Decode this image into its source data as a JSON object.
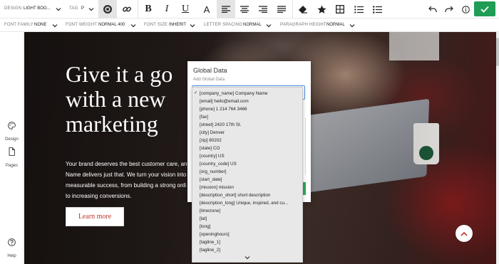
{
  "toolbar": {
    "design_label": "DESIGN",
    "design_value": "LIGHT BOO...",
    "tag_label": "TAG",
    "tag_value": "P",
    "buttons": [
      "palette-icon",
      "link-icon",
      "bold",
      "italic",
      "underline",
      "text-color",
      "align-left",
      "align-center",
      "align-right",
      "align-justify",
      "eraser-icon",
      "star-icon",
      "table-icon",
      "list-icon",
      "numbered-list-icon",
      "undo-icon",
      "redo-icon",
      "info-icon",
      "save-check-icon"
    ],
    "bold_label": "B",
    "italic_label": "I",
    "underline_label": "U",
    "color_label": "A"
  },
  "fontbar": {
    "family_label": "FONT FAMILY",
    "family_value": "NONE",
    "weight_label": "FONT WEIGHT",
    "weight_value": "NORMAL 400",
    "size_label": "FONT SIZE",
    "size_value": "INHERIT",
    "spacing_label": "LETTER SPACING",
    "spacing_value": "NORMAL",
    "para_label": "PARAGRAPH HEIGHT",
    "para_value": "NORMAL"
  },
  "sidebar": {
    "design": "Design",
    "pages": "Pages",
    "help": "Help"
  },
  "hero": {
    "title_lines": [
      "Give it a go",
      "with a new",
      "marketing"
    ],
    "body_lines": [
      "Your brand deserves the best customer care, and",
      "Name delivers just that. We turn your vision into",
      "measurable success, from building a strong onli",
      "to increasing conversions."
    ],
    "button": "Learn more"
  },
  "global_data": {
    "title": "Global Data",
    "subtitle": "Add Global Data",
    "items": [
      "[company_name] Company Name",
      "[email] hello@email.com",
      "[phone] 1 214 764 3466",
      "[fax]",
      "[street] 2420 17th St.",
      "[city] Denver",
      "[zip] 80202",
      "[state] CO",
      "[country] US",
      "[country_code] US",
      "[org_number]",
      "[start_date]",
      "[mission] mission",
      "[description_short] short description",
      "[description_long] Unique, inspired, and cu...",
      "[timezone]",
      "[lat]",
      "[long]",
      "[openinghours]",
      "[tagline_1]",
      "[tagline_2]"
    ],
    "selected_index": 0
  },
  "colors": {
    "save_green": "#1f9d55",
    "accent_blue": "#4a90e2",
    "button_text_red": "#c0392b"
  }
}
